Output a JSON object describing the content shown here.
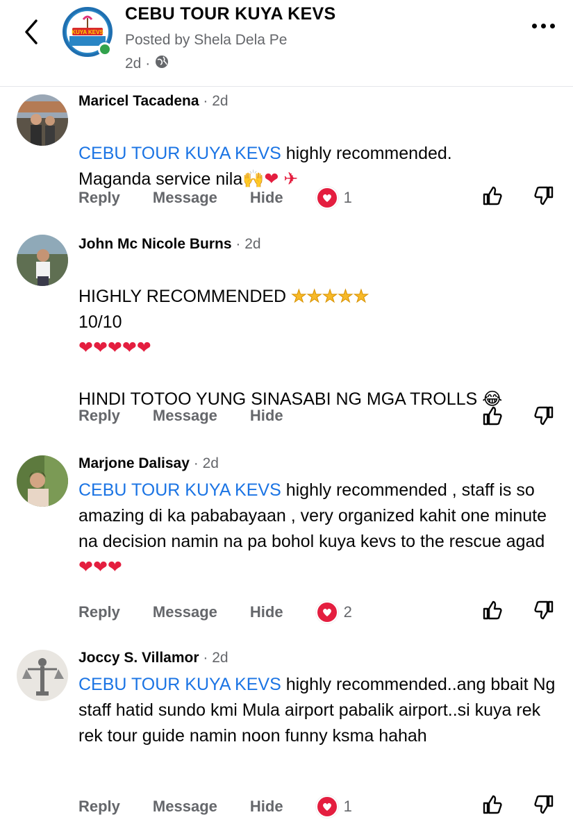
{
  "header": {
    "page_name": "CEBU TOUR KUYA KEVS",
    "posted_by": "Posted by Shela Dela Pe",
    "age": "2d ·",
    "logo_text": "KUYA KEVS"
  },
  "actions": {
    "reply": "Reply",
    "message": "Message",
    "hide": "Hide"
  },
  "comments": [
    {
      "name": "Maricel Tacadena",
      "time": "· 2d",
      "tag": "CEBU TOUR KUYA KEVS",
      "text1": " highly recommended.",
      "text2": "Maganda service nila🙌",
      "emojis": "❤ ✈",
      "reaction_count": "1"
    },
    {
      "name": "John Mc Nicole Burns",
      "time": "· 2d",
      "line1": "HIGHLY RECOMMENDED",
      "stars": "★★★★★",
      "line2": "10/10",
      "hearts": "❤❤❤❤❤",
      "line3": "HINDI TOTOO YUNG SINASABI NG MGA TROLLS 😂"
    },
    {
      "name": "Marjone Dalisay",
      "time": "· 2d",
      "tag": "CEBU TOUR KUYA KEVS",
      "text": " highly recommended , staff is so amazing di ka pababayaan , very organized kahit one minute na decision namin na pa bohol  kuya kevs to the rescue agad ",
      "hearts": "❤❤❤",
      "reaction_count": "2"
    },
    {
      "name": "Joccy S. Villamor",
      "time": "· 2d",
      "tag": "CEBU TOUR KUYA KEVS",
      "text": "  highly recommended..ang bbait Ng staff hatid sundo kmi Mula airport pabalik airport..si kuya rek rek tour guide namin noon funny ksma hahah",
      "reaction_count": "1"
    }
  ],
  "colors": {
    "link": "#1b74e4",
    "heart": "#e41e3f",
    "secondary": "#65676b",
    "online": "#31a24c"
  },
  "icons": [
    "back-arrow-icon",
    "globe-icon",
    "more-icon",
    "heart-reaction-icon",
    "like-icon",
    "dislike-icon"
  ]
}
